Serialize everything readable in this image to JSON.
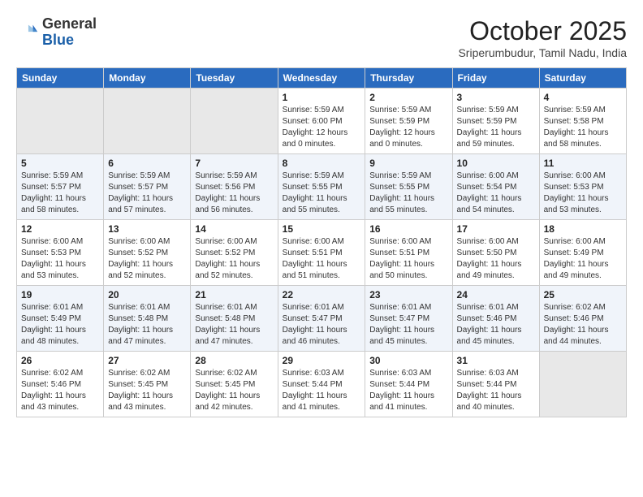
{
  "header": {
    "logo_text_general": "General",
    "logo_text_blue": "Blue",
    "month_title": "October 2025",
    "location": "Sriperumbudur, Tamil Nadu, India"
  },
  "columns": [
    "Sunday",
    "Monday",
    "Tuesday",
    "Wednesday",
    "Thursday",
    "Friday",
    "Saturday"
  ],
  "weeks": [
    [
      {
        "day": "",
        "sunrise": "",
        "sunset": "",
        "daylight": "",
        "empty": true
      },
      {
        "day": "",
        "sunrise": "",
        "sunset": "",
        "daylight": "",
        "empty": true
      },
      {
        "day": "",
        "sunrise": "",
        "sunset": "",
        "daylight": "",
        "empty": true
      },
      {
        "day": "1",
        "sunrise": "Sunrise: 5:59 AM",
        "sunset": "Sunset: 6:00 PM",
        "daylight": "Daylight: 12 hours and 0 minutes."
      },
      {
        "day": "2",
        "sunrise": "Sunrise: 5:59 AM",
        "sunset": "Sunset: 5:59 PM",
        "daylight": "Daylight: 12 hours and 0 minutes."
      },
      {
        "day": "3",
        "sunrise": "Sunrise: 5:59 AM",
        "sunset": "Sunset: 5:59 PM",
        "daylight": "Daylight: 11 hours and 59 minutes."
      },
      {
        "day": "4",
        "sunrise": "Sunrise: 5:59 AM",
        "sunset": "Sunset: 5:58 PM",
        "daylight": "Daylight: 11 hours and 58 minutes."
      }
    ],
    [
      {
        "day": "5",
        "sunrise": "Sunrise: 5:59 AM",
        "sunset": "Sunset: 5:57 PM",
        "daylight": "Daylight: 11 hours and 58 minutes."
      },
      {
        "day": "6",
        "sunrise": "Sunrise: 5:59 AM",
        "sunset": "Sunset: 5:57 PM",
        "daylight": "Daylight: 11 hours and 57 minutes."
      },
      {
        "day": "7",
        "sunrise": "Sunrise: 5:59 AM",
        "sunset": "Sunset: 5:56 PM",
        "daylight": "Daylight: 11 hours and 56 minutes."
      },
      {
        "day": "8",
        "sunrise": "Sunrise: 5:59 AM",
        "sunset": "Sunset: 5:55 PM",
        "daylight": "Daylight: 11 hours and 55 minutes."
      },
      {
        "day": "9",
        "sunrise": "Sunrise: 5:59 AM",
        "sunset": "Sunset: 5:55 PM",
        "daylight": "Daylight: 11 hours and 55 minutes."
      },
      {
        "day": "10",
        "sunrise": "Sunrise: 6:00 AM",
        "sunset": "Sunset: 5:54 PM",
        "daylight": "Daylight: 11 hours and 54 minutes."
      },
      {
        "day": "11",
        "sunrise": "Sunrise: 6:00 AM",
        "sunset": "Sunset: 5:53 PM",
        "daylight": "Daylight: 11 hours and 53 minutes."
      }
    ],
    [
      {
        "day": "12",
        "sunrise": "Sunrise: 6:00 AM",
        "sunset": "Sunset: 5:53 PM",
        "daylight": "Daylight: 11 hours and 53 minutes."
      },
      {
        "day": "13",
        "sunrise": "Sunrise: 6:00 AM",
        "sunset": "Sunset: 5:52 PM",
        "daylight": "Daylight: 11 hours and 52 minutes."
      },
      {
        "day": "14",
        "sunrise": "Sunrise: 6:00 AM",
        "sunset": "Sunset: 5:52 PM",
        "daylight": "Daylight: 11 hours and 52 minutes."
      },
      {
        "day": "15",
        "sunrise": "Sunrise: 6:00 AM",
        "sunset": "Sunset: 5:51 PM",
        "daylight": "Daylight: 11 hours and 51 minutes."
      },
      {
        "day": "16",
        "sunrise": "Sunrise: 6:00 AM",
        "sunset": "Sunset: 5:51 PM",
        "daylight": "Daylight: 11 hours and 50 minutes."
      },
      {
        "day": "17",
        "sunrise": "Sunrise: 6:00 AM",
        "sunset": "Sunset: 5:50 PM",
        "daylight": "Daylight: 11 hours and 49 minutes."
      },
      {
        "day": "18",
        "sunrise": "Sunrise: 6:00 AM",
        "sunset": "Sunset: 5:49 PM",
        "daylight": "Daylight: 11 hours and 49 minutes."
      }
    ],
    [
      {
        "day": "19",
        "sunrise": "Sunrise: 6:01 AM",
        "sunset": "Sunset: 5:49 PM",
        "daylight": "Daylight: 11 hours and 48 minutes."
      },
      {
        "day": "20",
        "sunrise": "Sunrise: 6:01 AM",
        "sunset": "Sunset: 5:48 PM",
        "daylight": "Daylight: 11 hours and 47 minutes."
      },
      {
        "day": "21",
        "sunrise": "Sunrise: 6:01 AM",
        "sunset": "Sunset: 5:48 PM",
        "daylight": "Daylight: 11 hours and 47 minutes."
      },
      {
        "day": "22",
        "sunrise": "Sunrise: 6:01 AM",
        "sunset": "Sunset: 5:47 PM",
        "daylight": "Daylight: 11 hours and 46 minutes."
      },
      {
        "day": "23",
        "sunrise": "Sunrise: 6:01 AM",
        "sunset": "Sunset: 5:47 PM",
        "daylight": "Daylight: 11 hours and 45 minutes."
      },
      {
        "day": "24",
        "sunrise": "Sunrise: 6:01 AM",
        "sunset": "Sunset: 5:46 PM",
        "daylight": "Daylight: 11 hours and 45 minutes."
      },
      {
        "day": "25",
        "sunrise": "Sunrise: 6:02 AM",
        "sunset": "Sunset: 5:46 PM",
        "daylight": "Daylight: 11 hours and 44 minutes."
      }
    ],
    [
      {
        "day": "26",
        "sunrise": "Sunrise: 6:02 AM",
        "sunset": "Sunset: 5:46 PM",
        "daylight": "Daylight: 11 hours and 43 minutes."
      },
      {
        "day": "27",
        "sunrise": "Sunrise: 6:02 AM",
        "sunset": "Sunset: 5:45 PM",
        "daylight": "Daylight: 11 hours and 43 minutes."
      },
      {
        "day": "28",
        "sunrise": "Sunrise: 6:02 AM",
        "sunset": "Sunset: 5:45 PM",
        "daylight": "Daylight: 11 hours and 42 minutes."
      },
      {
        "day": "29",
        "sunrise": "Sunrise: 6:03 AM",
        "sunset": "Sunset: 5:44 PM",
        "daylight": "Daylight: 11 hours and 41 minutes."
      },
      {
        "day": "30",
        "sunrise": "Sunrise: 6:03 AM",
        "sunset": "Sunset: 5:44 PM",
        "daylight": "Daylight: 11 hours and 41 minutes."
      },
      {
        "day": "31",
        "sunrise": "Sunrise: 6:03 AM",
        "sunset": "Sunset: 5:44 PM",
        "daylight": "Daylight: 11 hours and 40 minutes."
      },
      {
        "day": "",
        "sunrise": "",
        "sunset": "",
        "daylight": "",
        "empty": true
      }
    ]
  ]
}
